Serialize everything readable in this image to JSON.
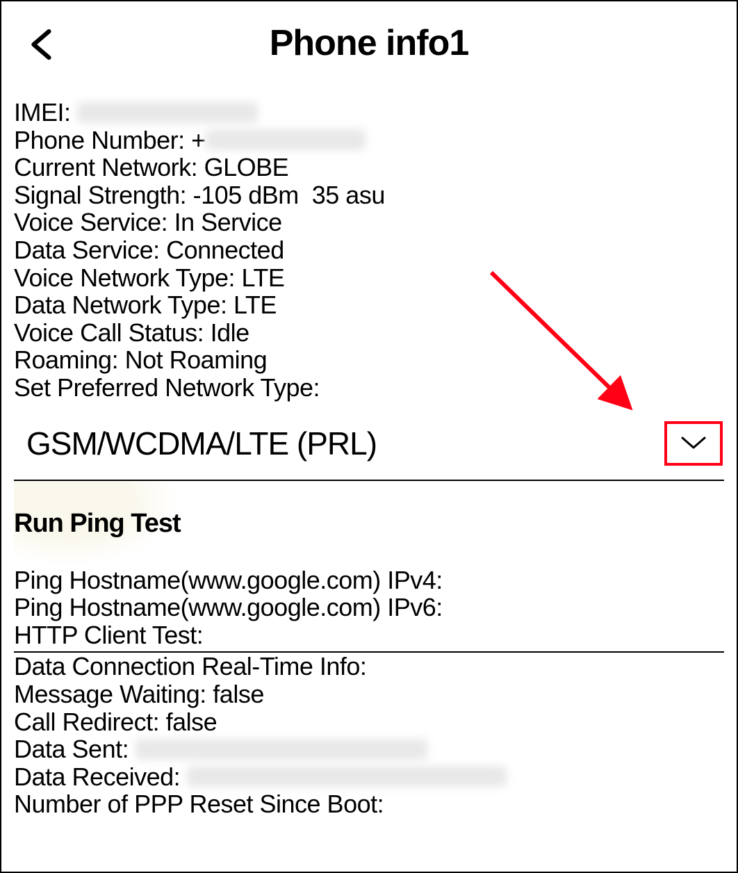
{
  "header": {
    "title": "Phone info1"
  },
  "info": {
    "imei_label": "IMEI: ",
    "phone_number_label": "Phone Number: ",
    "phone_number_prefix": "+",
    "current_network_label": "Current Network: ",
    "current_network_value": "GLOBE",
    "signal_strength_label": "Signal Strength: ",
    "signal_strength_value": "-105 dBm  35 asu",
    "voice_service_label": "Voice Service: ",
    "voice_service_value": "In Service",
    "data_service_label": "Data Service: ",
    "data_service_value": "Connected",
    "voice_network_type_label": "Voice Network Type: ",
    "voice_network_type_value": "LTE",
    "data_network_type_label": "Data Network Type: ",
    "data_network_type_value": "LTE",
    "voice_call_status_label": "Voice Call Status: ",
    "voice_call_status_value": "Idle",
    "roaming_label": "Roaming: ",
    "roaming_value": "Not Roaming",
    "preferred_network_label": "Set Preferred Network Type:"
  },
  "dropdown": {
    "selected": "GSM/WCDMA/LTE (PRL)"
  },
  "ping": {
    "button_label": "Run Ping Test",
    "ipv4_label": "Ping Hostname(www.google.com) IPv4:",
    "ipv6_label": "Ping Hostname(www.google.com) IPv6:",
    "http_client_label": "HTTP Client Test:"
  },
  "realtime": {
    "header_label": "Data Connection Real-Time Info:",
    "message_waiting_label": "Message Waiting: ",
    "message_waiting_value": "false",
    "call_redirect_label": "Call Redirect: ",
    "call_redirect_value": "false",
    "data_sent_label": "Data Sent: ",
    "data_received_label": "Data Received: ",
    "ppp_reset_label": "Number of PPP Reset Since Boot:"
  }
}
